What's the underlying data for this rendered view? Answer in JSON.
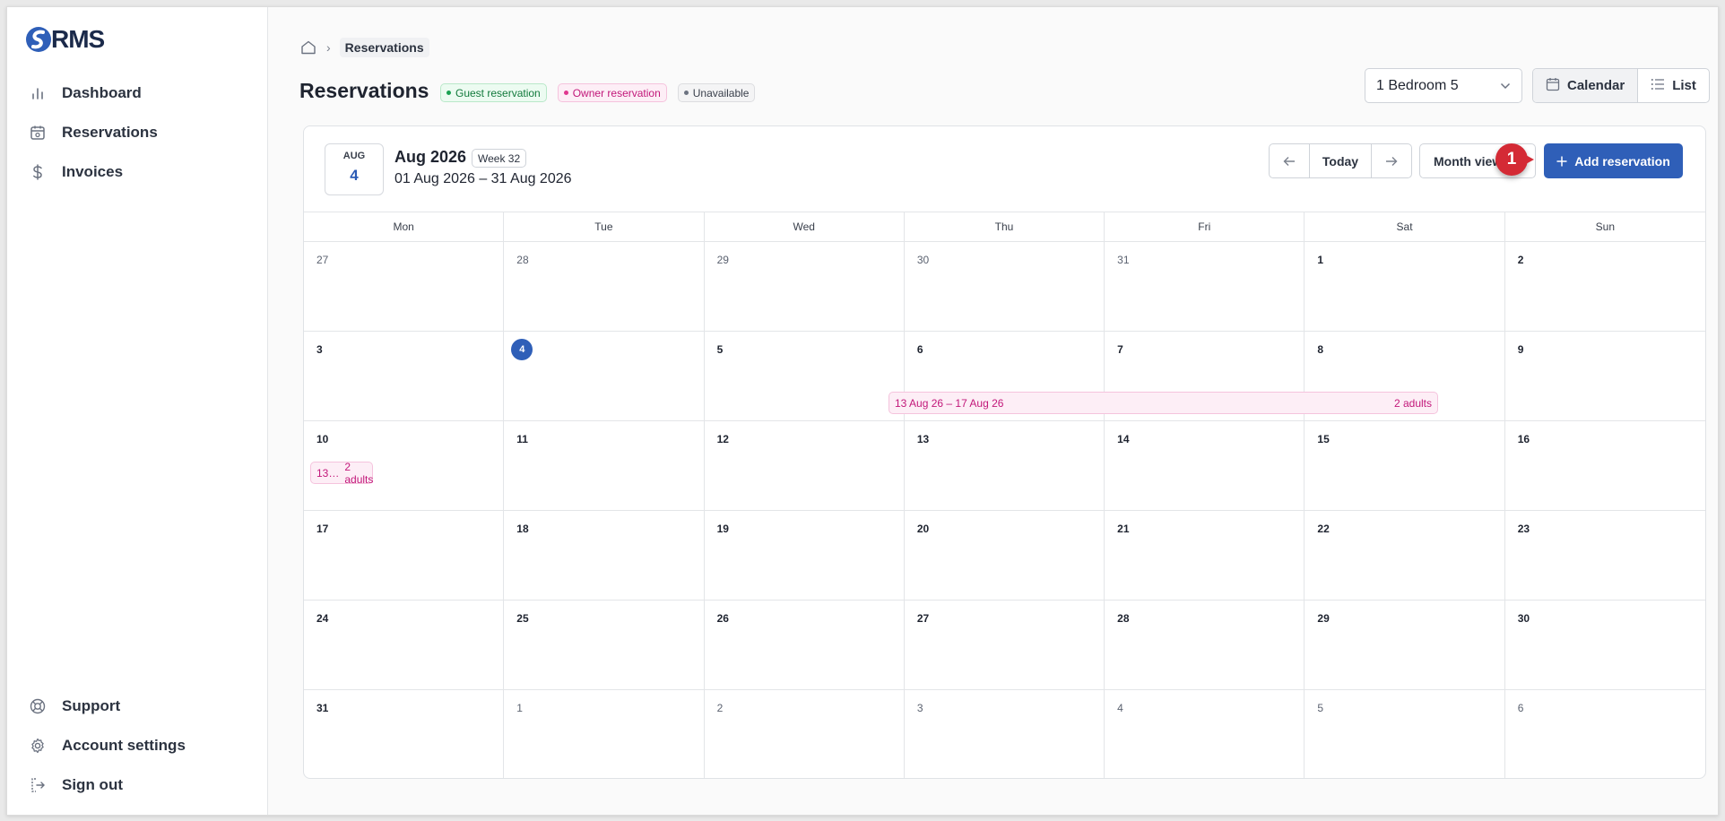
{
  "app": {
    "logo_text": "RMS"
  },
  "sidebar": {
    "items": [
      {
        "label": "Dashboard",
        "icon": "bar-chart-icon"
      },
      {
        "label": "Reservations",
        "icon": "calendar-icon"
      },
      {
        "label": "Invoices",
        "icon": "dollar-icon"
      }
    ],
    "bottom_items": [
      {
        "label": "Support",
        "icon": "lifebuoy-icon"
      },
      {
        "label": "Account settings",
        "icon": "gear-icon"
      },
      {
        "label": "Sign out",
        "icon": "sign-out-icon"
      }
    ]
  },
  "breadcrumb": {
    "current": "Reservations"
  },
  "page": {
    "title": "Reservations",
    "legend": {
      "guest": "Guest reservation",
      "owner": "Owner reservation",
      "unavailable": "Unavailable"
    }
  },
  "property_select": {
    "value": "1 Bedroom 5"
  },
  "view_toggle": {
    "calendar": "Calendar",
    "list": "List",
    "active": "Calendar"
  },
  "calendar": {
    "datebox": {
      "month": "AUG",
      "day": "4"
    },
    "month_title": "Aug 2026",
    "week_badge": "Week 32",
    "range": "01 Aug 2026 – 31 Aug 2026",
    "today_label": "Today",
    "view_mode": "Month view",
    "add_label": "Add reservation",
    "marker": "1",
    "weekdays": [
      "Mon",
      "Tue",
      "Wed",
      "Thu",
      "Fri",
      "Sat",
      "Sun"
    ],
    "days": [
      "27",
      "28",
      "29",
      "30",
      "31",
      "1",
      "2",
      "3",
      "4",
      "5",
      "6",
      "7",
      "8",
      "9",
      "10",
      "11",
      "12",
      "13",
      "14",
      "15",
      "16",
      "17",
      "18",
      "19",
      "20",
      "21",
      "22",
      "23",
      "24",
      "25",
      "26",
      "27",
      "28",
      "29",
      "30",
      "31",
      "1",
      "2",
      "3",
      "4",
      "5",
      "6"
    ],
    "today_index": 8,
    "events": [
      {
        "label": "13 Aug 26 – 17 Aug 26",
        "guests": "2 adults"
      },
      {
        "label": "13…",
        "guests": "2 adults"
      }
    ]
  },
  "colors": {
    "accent": "#2f5fb8",
    "owner": "#c2187a",
    "guest": "#127a3c",
    "marker": "#d42a35"
  }
}
